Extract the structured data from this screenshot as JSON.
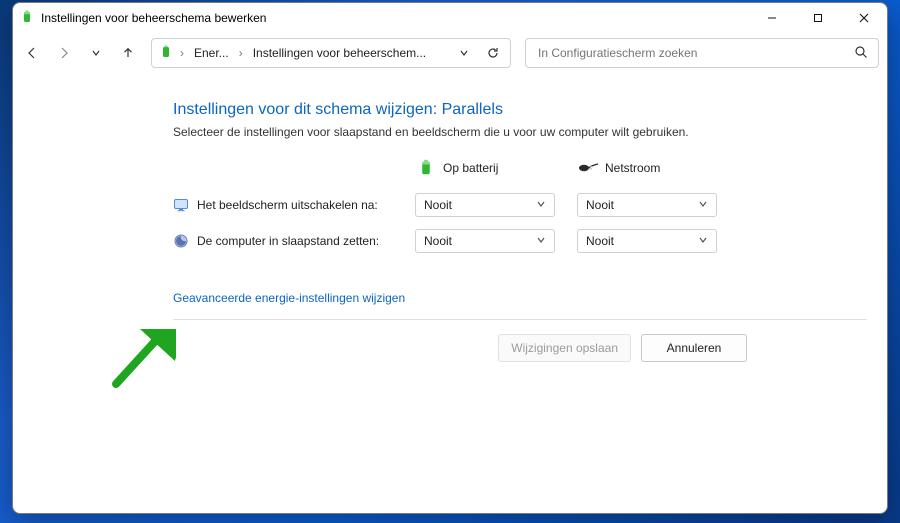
{
  "titlebar": {
    "title": "Instellingen voor beheerschema bewerken"
  },
  "nav": {
    "breadcrumb": {
      "seg1": "Ener...",
      "seg2": "Instellingen voor beheerschem..."
    },
    "search_placeholder": "In Configuratiescherm zoeken"
  },
  "page": {
    "heading": "Instellingen voor dit schema wijzigen: Parallels",
    "subtext": "Selecteer de instellingen voor slaapstand en beeldscherm die u voor uw computer wilt gebruiken.",
    "col_battery": "Op batterij",
    "col_plugged": "Netstroom",
    "row_display_label": "Het beeldscherm uitschakelen na:",
    "row_sleep_label": "De computer in slaapstand zetten:",
    "display_battery_value": "Nooit",
    "display_plugged_value": "Nooit",
    "sleep_battery_value": "Nooit",
    "sleep_plugged_value": "Nooit",
    "advanced_link": "Geavanceerde energie-instellingen wijzigen",
    "save_label": "Wijzigingen opslaan",
    "cancel_label": "Annuleren"
  },
  "colors": {
    "link": "#0a66c2",
    "arrow": "#1fa51f"
  }
}
